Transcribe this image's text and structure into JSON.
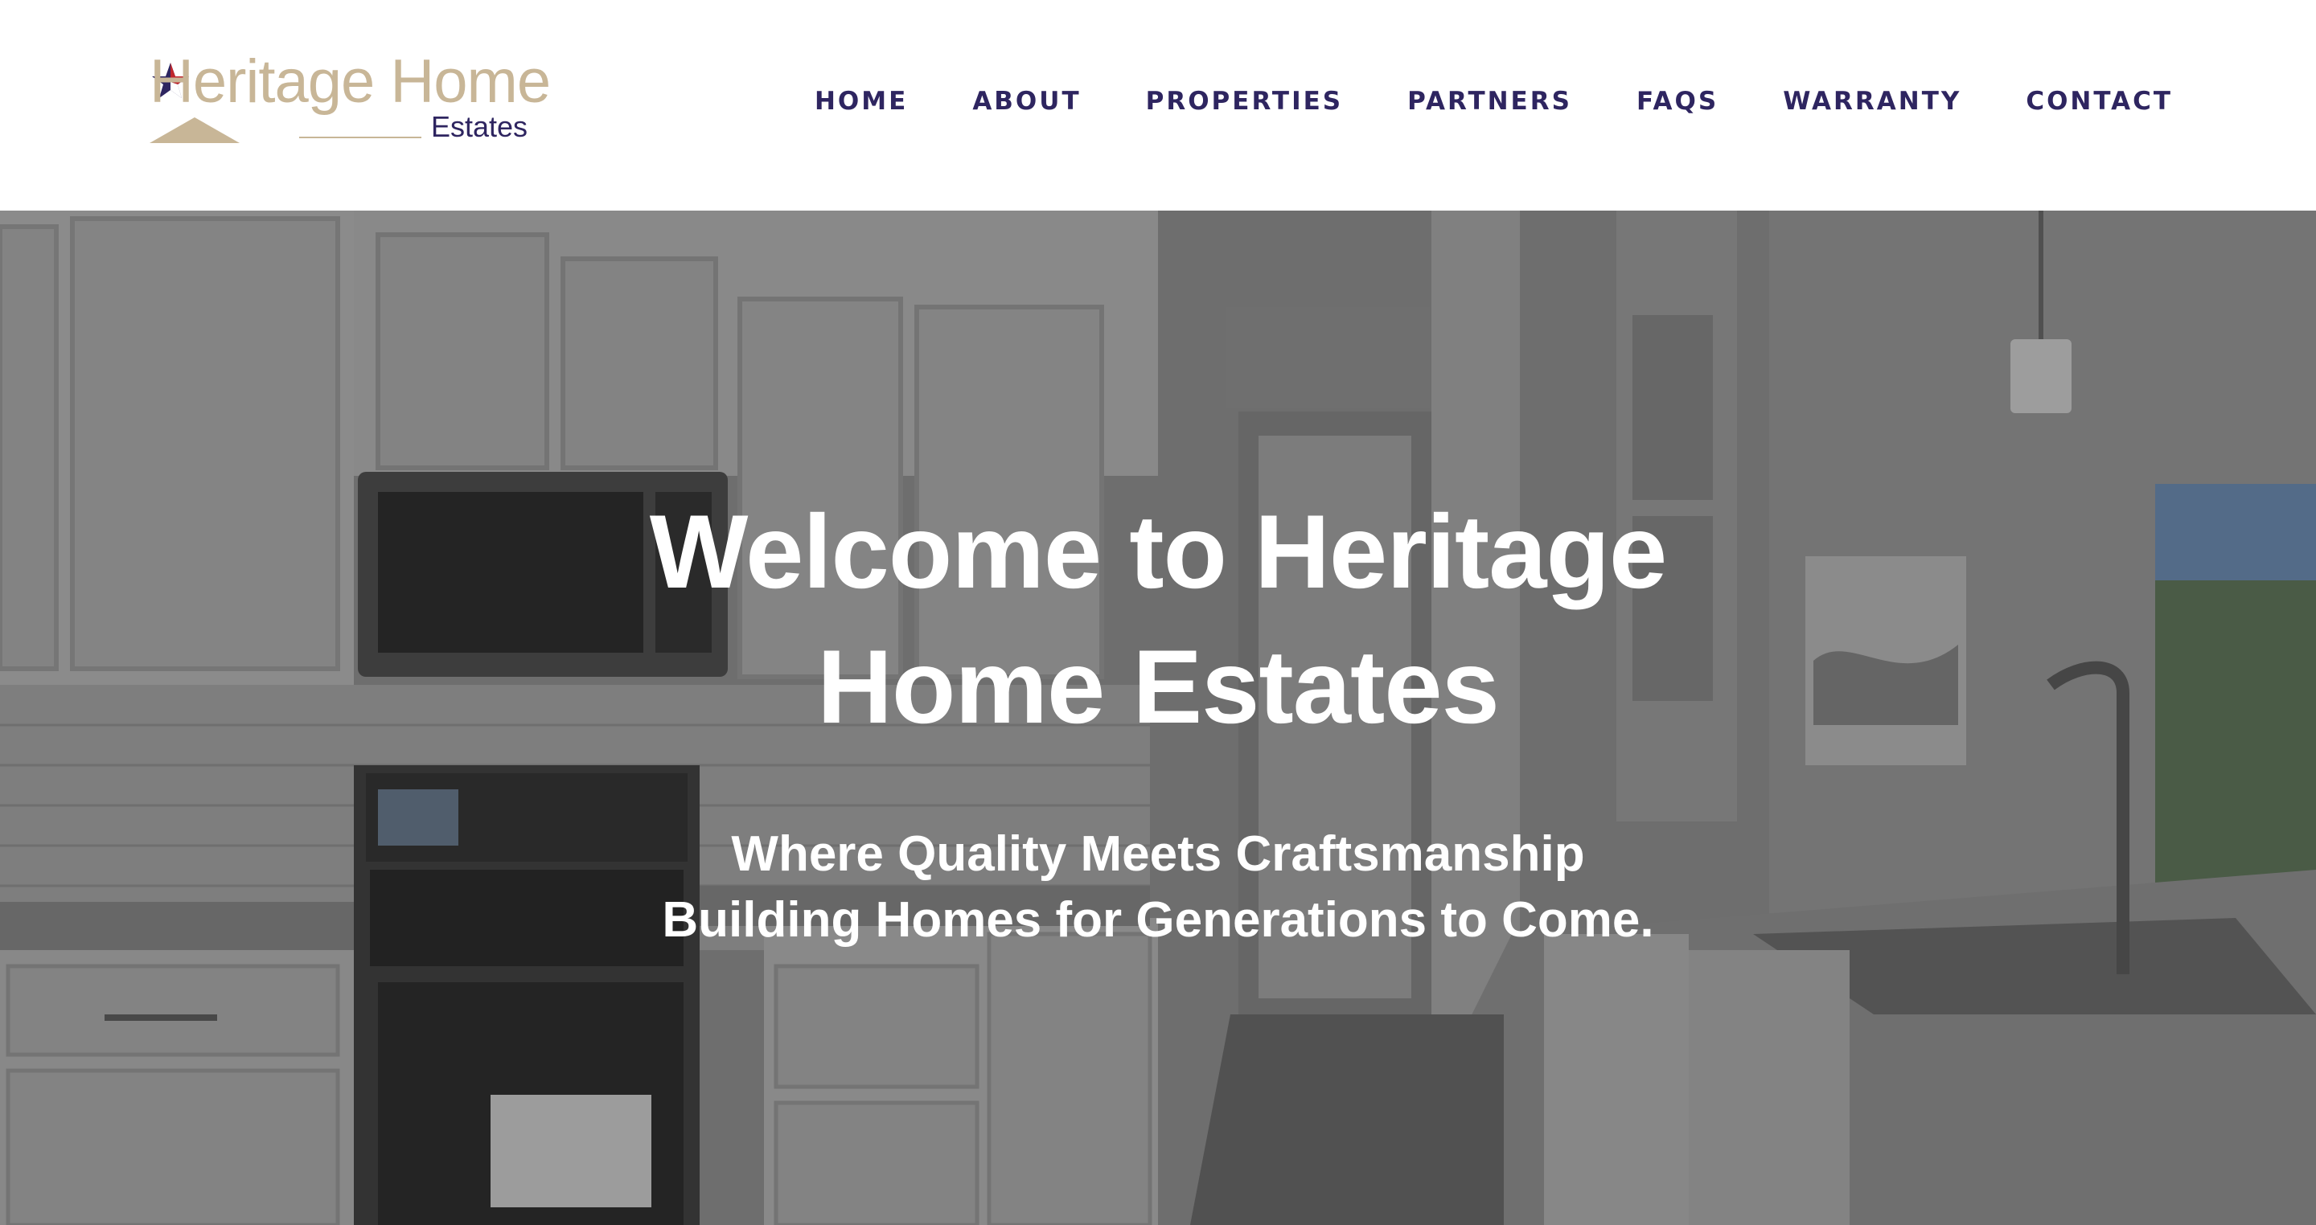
{
  "brand": {
    "logo_line1": "Heritage Home",
    "logo_line2": "Estates",
    "logo_colors": {
      "gold": "#c8b697",
      "navy": "#2e2560",
      "red": "#c0272d"
    },
    "logo_icon": "texas-star-icon"
  },
  "nav": {
    "items": [
      {
        "label": "HOME"
      },
      {
        "label": "ABOUT"
      },
      {
        "label": "PROPERTIES"
      },
      {
        "label": "PARTNERS"
      },
      {
        "label": "FAQS"
      },
      {
        "label": "WARRANTY"
      },
      {
        "label": "CONTACT"
      }
    ],
    "color": "#2e2560"
  },
  "hero": {
    "title_line1": "Welcome to Heritage",
    "title_line2": "Home Estates",
    "subtitle_line1": "Where Quality Meets Craftsmanship",
    "subtitle_line2": "Building Homes for Generations to Come.",
    "background": "kitchen-photo"
  }
}
